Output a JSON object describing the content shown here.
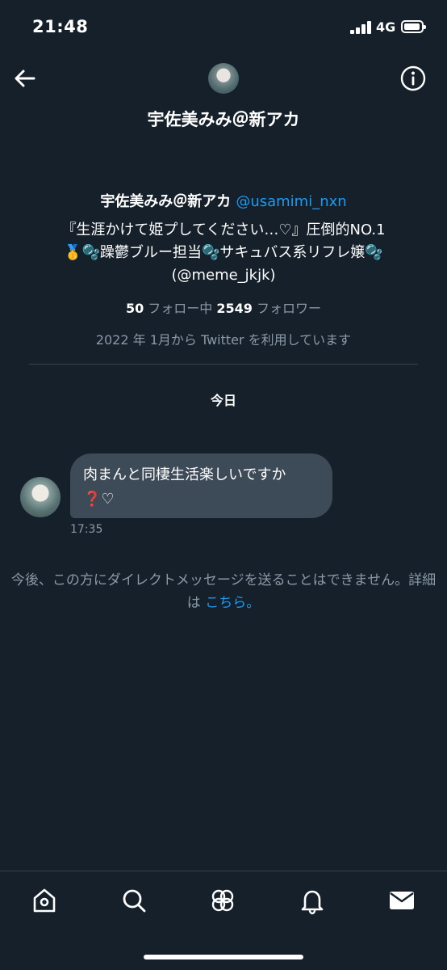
{
  "status_bar": {
    "time": "21:48",
    "network": "4G"
  },
  "header": {
    "title": "宇佐美みみ＠新アカ"
  },
  "profile": {
    "name": "宇佐美みみ＠新アカ",
    "handle": "@usamimi_nxn",
    "bio_line1": "『生涯かけて姫プしてください…♡』圧倒的NO.1",
    "bio_line2": "🥇🫧躁鬱ブルー担当🫧サキュバス系リフレ嬢🫧",
    "bio_line3": "(@meme_jkjk)",
    "following_count": "50",
    "following_label": "フォロー中",
    "followers_count": "2549",
    "followers_label": "フォロワー",
    "joined": "2022 年 1月から Twitter を利用しています"
  },
  "conversation": {
    "day_label": "今日",
    "message_line1": "肉まんと同棲生活楽しいですか",
    "message_line2": "❓♡",
    "message_time": "17:35"
  },
  "notice": {
    "text": "今後、この方にダイレクトメッセージを送ることはできません。詳細は",
    "link": "こちら。"
  },
  "tabs": [
    "home-icon",
    "search-icon",
    "communities-icon",
    "notifications-icon",
    "messages-icon"
  ]
}
